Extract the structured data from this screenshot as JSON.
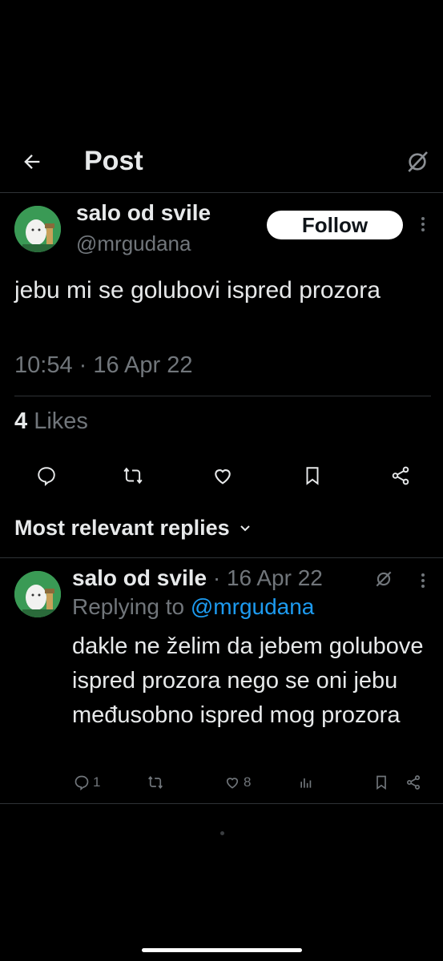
{
  "header": {
    "title": "Post"
  },
  "post": {
    "author_name": "salo od svile",
    "author_handle": "@mrgudana",
    "follow_label": "Follow",
    "text": "jebu mi se golubovi ispred prozora",
    "timestamp": "10:54 · 16 Apr 22",
    "likes_count": "4",
    "likes_label": "Likes"
  },
  "replies_section": {
    "heading": "Most relevant replies"
  },
  "reply": {
    "author_name": "salo od svile",
    "date": "· 16 Apr 22",
    "replying_prefix": "Replying to",
    "replying_mention": "@mrgudana",
    "text": "dakle ne želim da jebem golubove ispred prozora nego se oni jebu međusobno ispred mog prozora",
    "reply_count": "1",
    "like_count": "8"
  },
  "colors": {
    "background": "#000000",
    "text_primary": "#e7e9ea",
    "text_secondary": "#71767b",
    "link": "#1d9bf0",
    "divider": "#2f3336",
    "avatar_bg": "#3a9a55"
  },
  "icons": [
    "back-arrow-icon",
    "grok-icon",
    "more-icon",
    "reply-icon",
    "repost-icon",
    "like-icon",
    "bookmark-icon",
    "share-icon",
    "views-icon",
    "chevron-down-icon"
  ]
}
